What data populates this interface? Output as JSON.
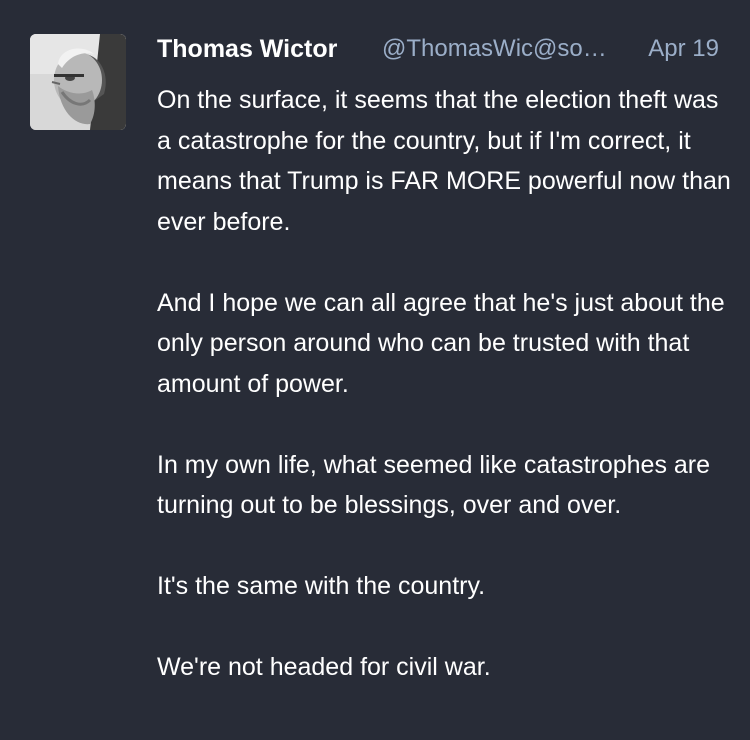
{
  "status": {
    "avatar_icon": "user-avatar",
    "display_name": "Thomas Wictor",
    "handle": "@ThomasWic@so…",
    "timestamp": "Apr 19",
    "paragraphs": [
      "On the surface, it seems that the election theft was a catastrophe for the country, but if I'm correct, it means that Trump is FAR MORE powerful now than ever before.",
      "And I hope we can all agree that he's just about the only person around who can be trusted with that amount of power.",
      "In my own life, what seemed like catastrophes are turning out to be blessings, over and over.",
      "It's the same with the country.",
      "We're not headed for civil war."
    ]
  },
  "colors": {
    "background": "#282c37",
    "text": "#ffffff",
    "secondary": "#9baec8"
  }
}
